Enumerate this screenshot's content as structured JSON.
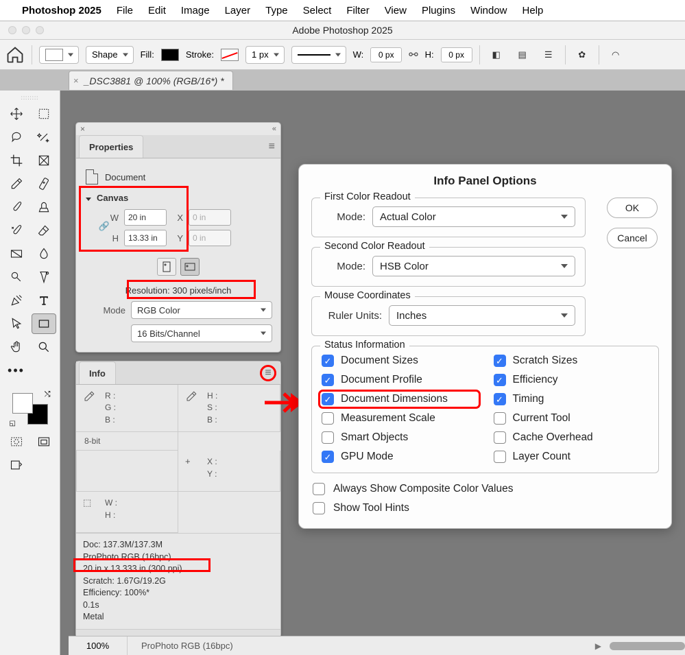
{
  "menubar": {
    "app": "Photoshop 2025",
    "items": [
      "File",
      "Edit",
      "Image",
      "Layer",
      "Type",
      "Select",
      "Filter",
      "View",
      "Plugins",
      "Window",
      "Help"
    ]
  },
  "window_title": "Adobe Photoshop 2025",
  "options_bar": {
    "tool_mode": "Shape",
    "fill_label": "Fill:",
    "stroke_label": "Stroke:",
    "stroke_width": "1 px",
    "w_label": "W:",
    "w_value": "0 px",
    "h_label": "H:",
    "h_value": "0 px"
  },
  "doc_tab": "_DSC3881 @ 100% (RGB/16*) *",
  "properties": {
    "tab": "Properties",
    "doc_label": "Document",
    "canvas_label": "Canvas",
    "w_label": "W",
    "w_value": "20 in",
    "h_label": "H",
    "h_value": "13.33 in",
    "x_label": "X",
    "x_value": "0 in",
    "y_label": "Y",
    "y_value": "0 in",
    "resolution": "Resolution: 300 pixels/inch",
    "mode_label": "Mode",
    "mode_value": "RGB Color",
    "depth_value": "16 Bits/Channel"
  },
  "info": {
    "tab": "Info",
    "rgb": {
      "r": "R :",
      "g": "G :",
      "b": "B :"
    },
    "hsb": {
      "h": "H :",
      "s": "S :",
      "b": "B :"
    },
    "bits": "8-bit",
    "xy": {
      "x": "X :",
      "y": "Y :"
    },
    "wh": {
      "w": "W :",
      "h": "H :"
    },
    "stats": {
      "doc": "Doc: 137.3M/137.3M",
      "profile": "ProPhoto RGB (16bpc)",
      "dims": "20 in x 13.333 in (300 ppi)",
      "scratch": "Scratch: 1.67G/19.2G",
      "efficiency": "Efficiency: 100%*",
      "time": "0.1s",
      "engine": "Metal"
    }
  },
  "dialog": {
    "title": "Info Panel Options",
    "first_readout": "First Color Readout",
    "second_readout": "Second Color Readout",
    "mode_label": "Mode:",
    "first_mode": "Actual Color",
    "second_mode": "HSB Color",
    "mouse_coords": "Mouse Coordinates",
    "ruler_label": "Ruler Units:",
    "ruler_value": "Inches",
    "status_label": "Status Information",
    "status_items": [
      {
        "label": "Document Sizes",
        "checked": true
      },
      {
        "label": "Scratch Sizes",
        "checked": true
      },
      {
        "label": "Document Profile",
        "checked": true
      },
      {
        "label": "Efficiency",
        "checked": true
      },
      {
        "label": "Document Dimensions",
        "checked": true,
        "highlight": true
      },
      {
        "label": "Timing",
        "checked": true
      },
      {
        "label": "Measurement Scale",
        "checked": false
      },
      {
        "label": "Current Tool",
        "checked": false
      },
      {
        "label": "Smart Objects",
        "checked": false
      },
      {
        "label": "Cache Overhead",
        "checked": false
      },
      {
        "label": "GPU Mode",
        "checked": true
      },
      {
        "label": "Layer Count",
        "checked": false
      }
    ],
    "always_show": "Always Show Composite Color Values",
    "tool_hints": "Show Tool Hints",
    "ok": "OK",
    "cancel": "Cancel"
  },
  "statusbar": {
    "zoom": "100%",
    "text": "ProPhoto RGB (16bpc)"
  }
}
